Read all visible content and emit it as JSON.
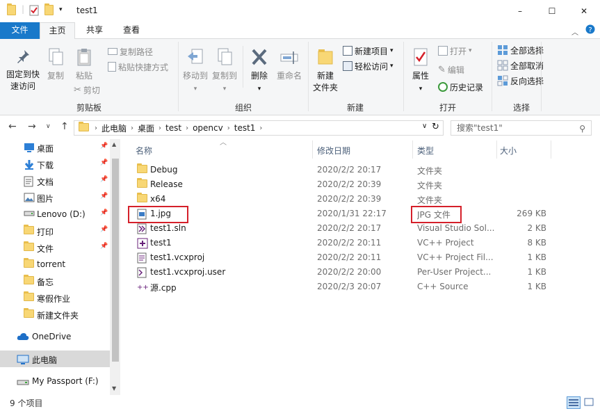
{
  "window": {
    "title": "test1",
    "controls": {
      "minimize": "–",
      "maximize": "☐",
      "close": "✕"
    }
  },
  "ribbon_tabs": [
    "文件",
    "主页",
    "共享",
    "查看"
  ],
  "ribbon": {
    "clipboard": {
      "pin_label_1": "固定到快",
      "pin_label_2": "速访问",
      "copy": "复制",
      "paste": "粘贴",
      "copy_path": "复制路径",
      "paste_shortcut": "粘贴快捷方式",
      "cut": "剪切",
      "group": "剪贴板"
    },
    "organize": {
      "move_to": "移动到",
      "copy_to": "复制到",
      "delete": "删除",
      "rename": "重命名",
      "group": "组织"
    },
    "new": {
      "new_folder_1": "新建",
      "new_folder_2": "文件夹",
      "new_item": "新建项目",
      "easy_access": "轻松访问",
      "group": "新建"
    },
    "open": {
      "properties": "属性",
      "open": "打开",
      "edit": "编辑",
      "history": "历史记录",
      "group": "打开"
    },
    "select": {
      "select_all": "全部选择",
      "select_none": "全部取消",
      "invert": "反向选择",
      "group": "选择"
    }
  },
  "address": {
    "breadcrumbs": [
      "此电脑",
      "桌面",
      "test",
      "opencv",
      "test1"
    ],
    "search_placeholder": "搜索\"test1\""
  },
  "nav": {
    "items": [
      {
        "label": "桌面",
        "icon": "desktop-icon",
        "pinned": true
      },
      {
        "label": "下载",
        "icon": "download-icon",
        "pinned": true
      },
      {
        "label": "文档",
        "icon": "document-icon",
        "pinned": true
      },
      {
        "label": "图片",
        "icon": "pictures-icon",
        "pinned": true
      },
      {
        "label": "Lenovo (D:)",
        "icon": "drive-icon",
        "pinned": true
      },
      {
        "label": "打印",
        "icon": "folder-icon",
        "pinned": true
      },
      {
        "label": "文件",
        "icon": "folder-icon",
        "pinned": true
      },
      {
        "label": "torrent",
        "icon": "folder-icon",
        "pinned": false
      },
      {
        "label": "备忘",
        "icon": "folder-icon",
        "pinned": false
      },
      {
        "label": "寒假作业",
        "icon": "folder-icon",
        "pinned": false
      },
      {
        "label": "新建文件夹",
        "icon": "folder-icon",
        "pinned": false
      }
    ],
    "onedrive": "OneDrive",
    "this_pc": "此电脑",
    "passport": "My Passport (F:)"
  },
  "columns": {
    "name": "名称",
    "date": "修改日期",
    "type": "类型",
    "size": "大小"
  },
  "files": [
    {
      "name": "Debug",
      "date": "2020/2/2 20:17",
      "type": "文件夹",
      "size": "",
      "icon": "folder-icon"
    },
    {
      "name": "Release",
      "date": "2020/2/2 20:39",
      "type": "文件夹",
      "size": "",
      "icon": "folder-icon"
    },
    {
      "name": "x64",
      "date": "2020/2/2 20:39",
      "type": "文件夹",
      "size": "",
      "icon": "folder-icon"
    },
    {
      "name": "1.jpg",
      "date": "2020/1/31 22:17",
      "type": "JPG 文件",
      "size": "269 KB",
      "icon": "image-file-icon"
    },
    {
      "name": "test1.sln",
      "date": "2020/2/2 20:17",
      "type": "Visual Studio Sol...",
      "size": "2 KB",
      "icon": "vs-solution-icon"
    },
    {
      "name": "test1",
      "date": "2020/2/2 20:11",
      "type": "VC++ Project",
      "size": "8 KB",
      "icon": "vc-project-icon"
    },
    {
      "name": "test1.vcxproj",
      "date": "2020/2/2 20:11",
      "type": "VC++ Project Fil...",
      "size": "1 KB",
      "icon": "vcxproj-icon"
    },
    {
      "name": "test1.vcxproj.user",
      "date": "2020/2/2 20:00",
      "type": "Per-User Project...",
      "size": "1 KB",
      "icon": "vs-user-icon"
    },
    {
      "name": "源.cpp",
      "date": "2020/2/3 20:07",
      "type": "C++ Source",
      "size": "1 KB",
      "icon": "cpp-file-icon"
    }
  ],
  "status": {
    "count": "9 个项目"
  },
  "colors": {
    "accent": "#1979ca",
    "highlight": "#d5202a"
  }
}
